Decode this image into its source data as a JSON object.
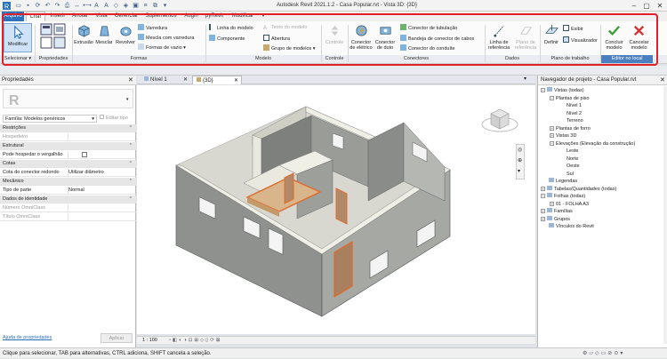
{
  "window": {
    "title": "Autodesk Revit 2021.1.2 - Casa Popular.rvt - Vista 3D: {3D}"
  },
  "menu": {
    "tabs": [
      "Arquivo",
      "Criar",
      "Inserir",
      "Anotar",
      "Vista",
      "Gerenciar",
      "Suplementos",
      "Augin",
      "pyRevit",
      "Modificar"
    ],
    "active_tab": "Criar"
  },
  "ribbon": {
    "selecionar": {
      "modificar": "Modificar",
      "panel": "Selecionar"
    },
    "propriedades": {
      "panel": "Propriedades"
    },
    "formas": {
      "extrusao": "Extrusão",
      "mesclar": "Mesclar",
      "revolver": "Revolver",
      "varredura": "Varredura",
      "mescla_varredura": "Mescla com varredura",
      "formas_vazio": "Formas de vazio",
      "panel": "Formas"
    },
    "modelo": {
      "linha_modelo": "Linha do modelo",
      "texto_modelo": "Texto do modelo",
      "componente": "Componente",
      "abertura": "Abertura",
      "grupo_modelos": "Grupo de modelos",
      "panel": "Modelo"
    },
    "controle": {
      "controle": "Controle",
      "panel": "Controle"
    },
    "conectores": {
      "eletrico": "Conector de elétrico",
      "duto": "Conector de duto",
      "tubulacao": "Conector de tubulação",
      "bandeja": "Bandeja de conector de cabos",
      "conduite": "Conector do conduíte",
      "panel": "Conectores"
    },
    "dados": {
      "linha_ref": "Linha de referência",
      "plano_ref": "Plano de referência",
      "panel": "Dados"
    },
    "plano": {
      "definir": "Definir",
      "exibir": "Exibir",
      "visualizador": "Visualizador",
      "panel": "Plano de trabalho"
    },
    "editor": {
      "concluir": "Concluir modelo",
      "cancelar": "Cancelar modelo",
      "panel": "Editor no local"
    }
  },
  "properties": {
    "title": "Propriedades",
    "family": "Família: Modelos genéricos",
    "edit_type": "Editar tipo",
    "rows": [
      {
        "k": "Restrições",
        "v": "",
        "type": "group"
      },
      {
        "k": "Hospedeiro",
        "v": "",
        "type": "gray"
      },
      {
        "k": "Estrutural",
        "v": "",
        "type": "group"
      },
      {
        "k": "Pode hospedar o vergalhão",
        "v": "",
        "type": "check"
      },
      {
        "k": "Cotas",
        "v": "",
        "type": "group"
      },
      {
        "k": "Cota do conector redondo",
        "v": "Utilizar diâmetro",
        "type": "normal"
      },
      {
        "k": "Mecânico",
        "v": "",
        "type": "group"
      },
      {
        "k": "Tipo de parte",
        "v": "Normal",
        "type": "normal"
      },
      {
        "k": "Dados de identidade",
        "v": "",
        "type": "group"
      },
      {
        "k": "Número OmniClass",
        "v": "",
        "type": "gray"
      },
      {
        "k": "Título OmniClass",
        "v": "",
        "type": "gray"
      }
    ],
    "help_link": "Ajuda de propriedades",
    "apply": "Aplicar"
  },
  "view_tabs": [
    "Nível 1",
    "{3D}"
  ],
  "active_view": "{3D}",
  "view_scale": "1 : 100",
  "browser": {
    "title": "Navegador de projeto - Casa Popular.rvt",
    "items": [
      {
        "label": "Vistas (todas)",
        "level": 0,
        "toggle": "−",
        "folder": true
      },
      {
        "label": "Plantas de piso",
        "level": 1,
        "toggle": "−"
      },
      {
        "label": "Nível 1",
        "level": 2
      },
      {
        "label": "Nível 2",
        "level": 2
      },
      {
        "label": "Terreno",
        "level": 2
      },
      {
        "label": "Plantas de forro",
        "level": 1,
        "toggle": "+"
      },
      {
        "label": "Vistas 3D",
        "level": 1,
        "toggle": "+"
      },
      {
        "label": "Elevações (Elevação da construção)",
        "level": 1,
        "toggle": "−"
      },
      {
        "label": "Leste",
        "level": 2
      },
      {
        "label": "Norte",
        "level": 2
      },
      {
        "label": "Oeste",
        "level": 2
      },
      {
        "label": "Sul",
        "level": 2
      },
      {
        "label": "Legendas",
        "level": 0,
        "folder": true
      },
      {
        "label": "Tabelas/Quantidades (todas)",
        "level": 0,
        "toggle": "+",
        "folder": true
      },
      {
        "label": "Folhas (todas)",
        "level": 0,
        "toggle": "−",
        "folder": true
      },
      {
        "label": "01 - FOLHA A3",
        "level": 1,
        "toggle": "+"
      },
      {
        "label": "Famílias",
        "level": 0,
        "toggle": "+",
        "folder": true
      },
      {
        "label": "Grupos",
        "level": 0,
        "toggle": "+",
        "folder": true
      },
      {
        "label": "Vínculos do Revit",
        "level": 0,
        "folder": true
      }
    ]
  },
  "status": "Clique para selecionar, TAB para alternativas, CTRL adiciona, SHIFT cancela a seleção.",
  "colors": {
    "accent": "#2d72bb",
    "highlight_box": "#e0202a",
    "panel_blue": "#4b7fc0"
  }
}
